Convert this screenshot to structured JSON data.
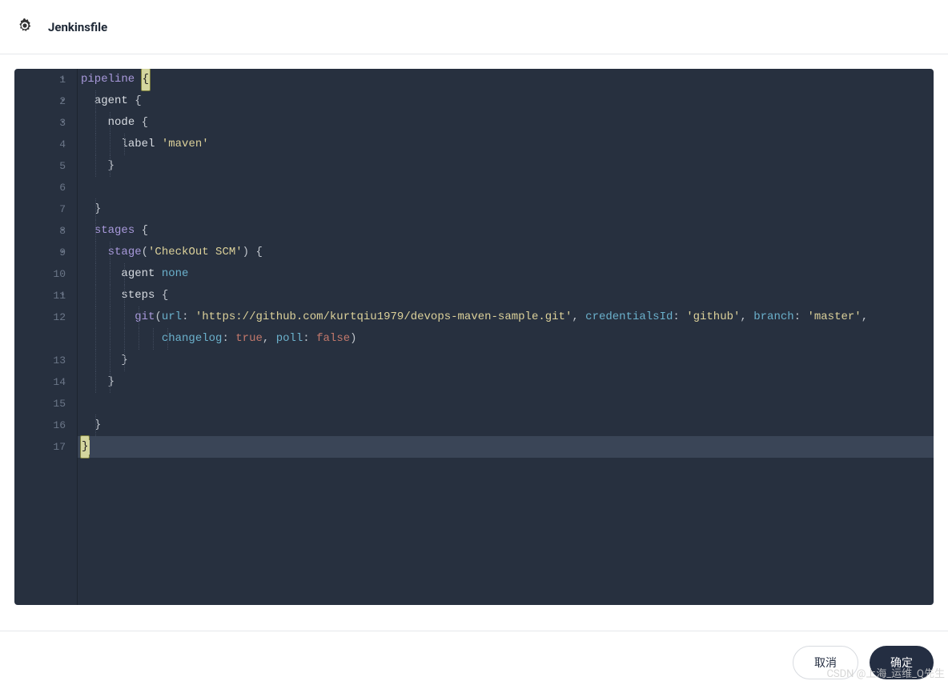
{
  "header": {
    "title": "Jenkinsfile",
    "icon": "gear-icon"
  },
  "editor": {
    "line_count": 17,
    "active_line": 17,
    "fold_lines": [
      1,
      2,
      3,
      8,
      9,
      11
    ],
    "code_lines": [
      {
        "n": 1,
        "indent": 0,
        "segments": [
          {
            "t": "pipeline ",
            "c": "name"
          },
          {
            "t": "{",
            "c": "bracket"
          }
        ]
      },
      {
        "n": 2,
        "indent": 1,
        "segments": [
          {
            "t": "agent ",
            "c": "plain"
          },
          {
            "t": "{",
            "c": "punc"
          }
        ]
      },
      {
        "n": 3,
        "indent": 2,
        "segments": [
          {
            "t": "node ",
            "c": "plain"
          },
          {
            "t": "{",
            "c": "punc"
          }
        ]
      },
      {
        "n": 4,
        "indent": 3,
        "segments": [
          {
            "t": "label ",
            "c": "plain"
          },
          {
            "t": "'maven'",
            "c": "str"
          }
        ]
      },
      {
        "n": 5,
        "indent": 2,
        "segments": [
          {
            "t": "}",
            "c": "punc"
          }
        ]
      },
      {
        "n": 6,
        "indent": 0,
        "segments": []
      },
      {
        "n": 7,
        "indent": 1,
        "segments": [
          {
            "t": "}",
            "c": "punc"
          }
        ]
      },
      {
        "n": 8,
        "indent": 1,
        "segments": [
          {
            "t": "stages ",
            "c": "name"
          },
          {
            "t": "{",
            "c": "punc"
          }
        ]
      },
      {
        "n": 9,
        "indent": 2,
        "segments": [
          {
            "t": "stage",
            "c": "name"
          },
          {
            "t": "(",
            "c": "punc"
          },
          {
            "t": "'CheckOut SCM'",
            "c": "str"
          },
          {
            "t": ") ",
            "c": "punc"
          },
          {
            "t": "{",
            "c": "punc"
          }
        ]
      },
      {
        "n": 10,
        "indent": 3,
        "segments": [
          {
            "t": "agent ",
            "c": "plain"
          },
          {
            "t": "none",
            "c": "kw"
          }
        ]
      },
      {
        "n": 11,
        "indent": 3,
        "segments": [
          {
            "t": "steps ",
            "c": "plain"
          },
          {
            "t": "{",
            "c": "punc"
          }
        ]
      },
      {
        "n": 12,
        "indent": 4,
        "segments": [
          {
            "t": "git",
            "c": "name"
          },
          {
            "t": "(",
            "c": "punc"
          },
          {
            "t": "url",
            "c": "attr"
          },
          {
            "t": ": ",
            "c": "punc"
          },
          {
            "t": "'https://github.com/kurtqiu1979/devops-maven-sample.git'",
            "c": "str"
          },
          {
            "t": ", ",
            "c": "punc"
          },
          {
            "t": "credentialsId",
            "c": "attr"
          },
          {
            "t": ": ",
            "c": "punc"
          },
          {
            "t": "'github'",
            "c": "str"
          },
          {
            "t": ", ",
            "c": "punc"
          },
          {
            "t": "branch",
            "c": "attr"
          },
          {
            "t": ": ",
            "c": "punc"
          },
          {
            "t": "'master'",
            "c": "str"
          },
          {
            "t": ", ",
            "c": "punc"
          }
        ]
      },
      {
        "n": "12b",
        "display": "",
        "indent": 6,
        "segments": [
          {
            "t": "changelog",
            "c": "attr"
          },
          {
            "t": ": ",
            "c": "punc"
          },
          {
            "t": "true",
            "c": "bool"
          },
          {
            "t": ", ",
            "c": "punc"
          },
          {
            "t": "poll",
            "c": "attr"
          },
          {
            "t": ": ",
            "c": "punc"
          },
          {
            "t": "false",
            "c": "bool"
          },
          {
            "t": ")",
            "c": "punc"
          }
        ]
      },
      {
        "n": 13,
        "indent": 3,
        "segments": [
          {
            "t": "}",
            "c": "punc"
          }
        ]
      },
      {
        "n": 14,
        "indent": 2,
        "segments": [
          {
            "t": "}",
            "c": "punc"
          }
        ]
      },
      {
        "n": 15,
        "indent": 0,
        "segments": []
      },
      {
        "n": 16,
        "indent": 1,
        "segments": [
          {
            "t": "}",
            "c": "punc"
          }
        ]
      },
      {
        "n": 17,
        "indent": 0,
        "segments": [
          {
            "t": "}",
            "c": "bracket"
          }
        ],
        "cursor_after": true
      }
    ]
  },
  "footer": {
    "cancel_label": "取消",
    "confirm_label": "确定"
  },
  "watermark": "CSDN @上海_运维_Q先生"
}
